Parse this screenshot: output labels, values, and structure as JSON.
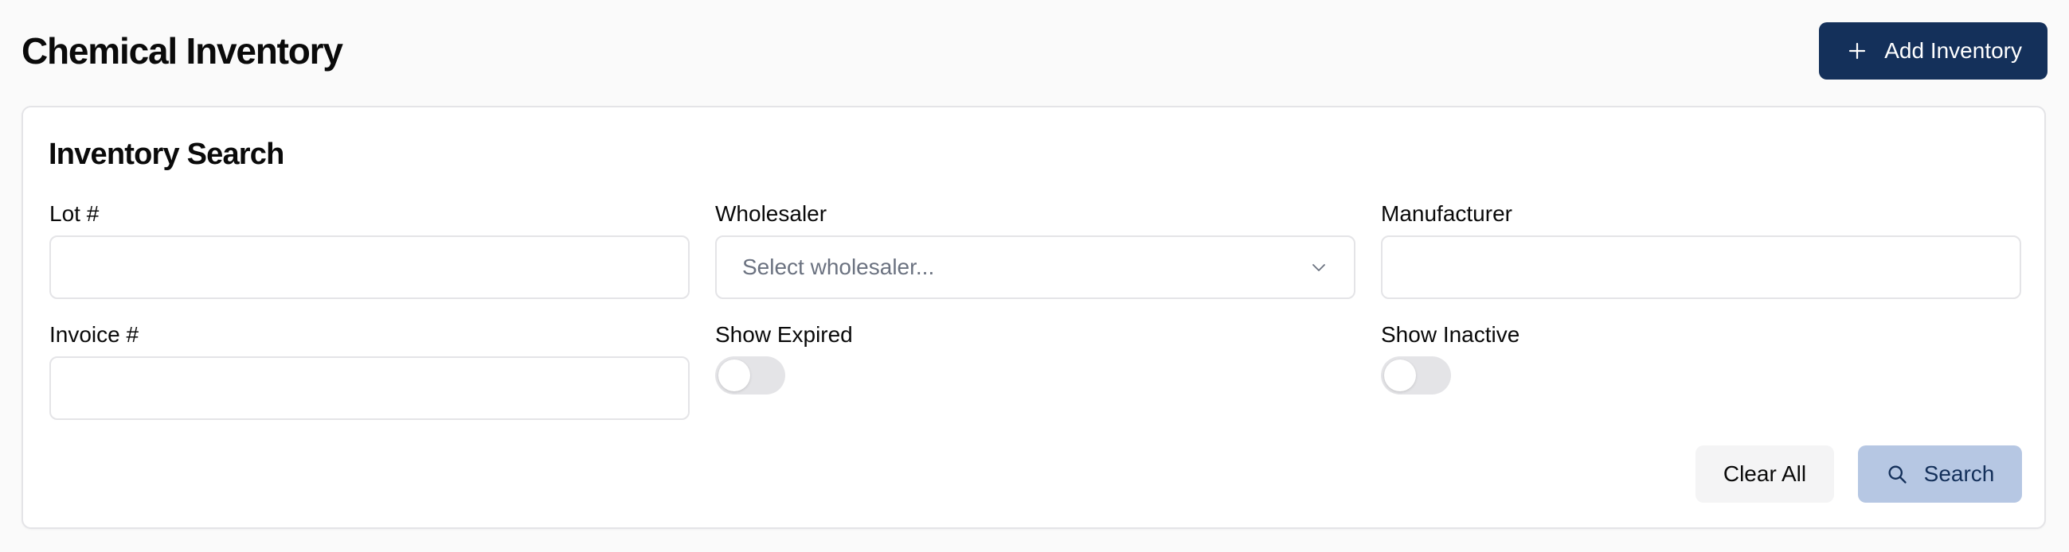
{
  "header": {
    "title": "Chemical Inventory",
    "add_button_label": "Add Inventory"
  },
  "search_card": {
    "title": "Inventory Search",
    "fields": {
      "lot": {
        "label": "Lot #",
        "value": ""
      },
      "wholesaler": {
        "label": "Wholesaler",
        "placeholder": "Select wholesaler..."
      },
      "manufacturer": {
        "label": "Manufacturer",
        "value": ""
      },
      "invoice": {
        "label": "Invoice #",
        "value": ""
      },
      "show_expired": {
        "label": "Show Expired",
        "checked": false
      },
      "show_inactive": {
        "label": "Show Inactive",
        "checked": false
      }
    },
    "clear_button_label": "Clear All",
    "search_button_label": "Search"
  },
  "colors": {
    "primary": "#14305a",
    "primary_disabled": "#b6c7e3",
    "border": "#e4e4e7",
    "toggle_off": "#e4e4e7",
    "muted_text": "#6b7280"
  },
  "icons": {
    "add": "plus-icon",
    "select": "chevron-down-icon",
    "search": "search-icon"
  }
}
